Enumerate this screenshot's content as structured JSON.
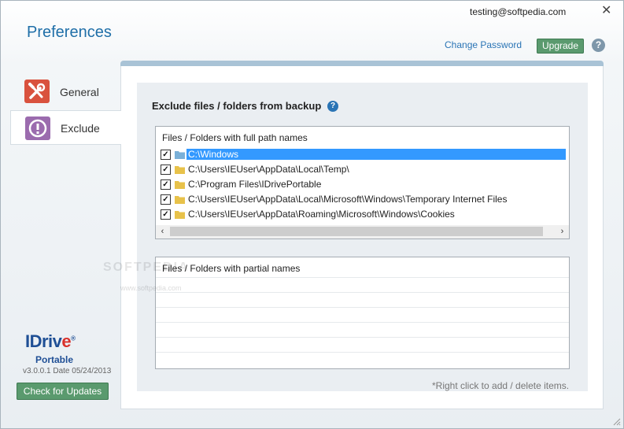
{
  "header": {
    "email": "testing@softpedia.com",
    "title": "Preferences",
    "change_password": "Change Password",
    "upgrade": "Upgrade",
    "help": "?"
  },
  "nav": {
    "items": [
      {
        "label": "General",
        "icon": "wrench-screwdriver-icon"
      },
      {
        "label": "Exclude",
        "icon": "exclamation-icon"
      }
    ]
  },
  "main": {
    "title": "Exclude files / folders from backup",
    "help": "?",
    "full_list": {
      "header": "Files / Folders with full path names",
      "rows": [
        {
          "path": "C:\\Windows",
          "checked": true,
          "selected": true
        },
        {
          "path": "C:\\Users\\IEUser\\AppData\\Local\\Temp\\",
          "checked": true,
          "selected": false
        },
        {
          "path": "C:\\Program Files\\IDrivePortable",
          "checked": true,
          "selected": false
        },
        {
          "path": "C:\\Users\\IEUser\\AppData\\Local\\Microsoft\\Windows\\Temporary Internet Files",
          "checked": true,
          "selected": false
        },
        {
          "path": "C:\\Users\\IEUser\\AppData\\Roaming\\Microsoft\\Windows\\Cookies",
          "checked": true,
          "selected": false
        }
      ]
    },
    "partial_list": {
      "header": "Files / Folders with partial names"
    },
    "footnote": "*Right click to add / delete items."
  },
  "brand": {
    "logo_text": "IDriv",
    "logo_e": "e",
    "logo_mark": "®",
    "portable": "Portable",
    "version": "v3.0.0.1 Date 05/24/2013",
    "check_updates": "Check for Updates"
  },
  "watermark": {
    "text": "SOFTPEDIA",
    "url": "www.softpedia.com"
  },
  "colors": {
    "accent": "#1f6fa8",
    "button_green": "#5a9a6e",
    "selection": "#3399ff",
    "general_icon": "#d9523e",
    "exclude_icon": "#9b6bae"
  }
}
